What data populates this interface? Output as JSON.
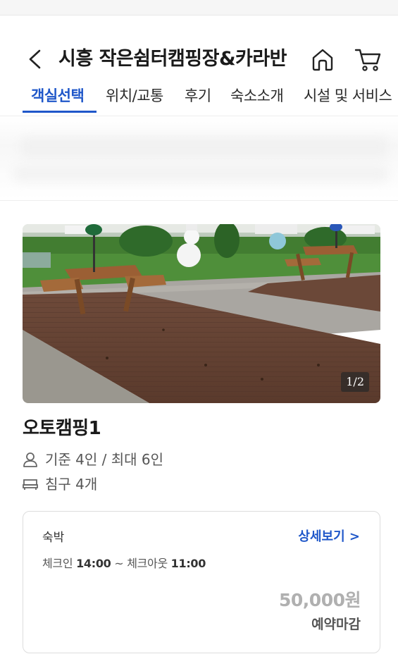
{
  "header": {
    "title": "시흥 작은쉼터캠핑장&카라반"
  },
  "tabs": [
    {
      "label": "객실선택",
      "active": true
    },
    {
      "label": "위치/교통",
      "active": false
    },
    {
      "label": "후기",
      "active": false
    },
    {
      "label": "숙소소개",
      "active": false
    },
    {
      "label": "시설 및 서비스",
      "active": false
    }
  ],
  "room": {
    "name": "오토캠핑1",
    "photo_counter": "1/2",
    "capacity": "기준 4인 / 최대 6인",
    "bedding": "침구 4개"
  },
  "rate_card": {
    "type": "숙박",
    "detail_label": "상세보기 >",
    "checkin_label": "체크인",
    "checkin_time": "14:00",
    "checkout_label": "~ 체크아웃",
    "checkout_time": "11:00",
    "price": "50,000원",
    "status": "예약마감"
  },
  "colors": {
    "accent": "#1f57c9",
    "price_disabled": "#b0b0b0"
  }
}
